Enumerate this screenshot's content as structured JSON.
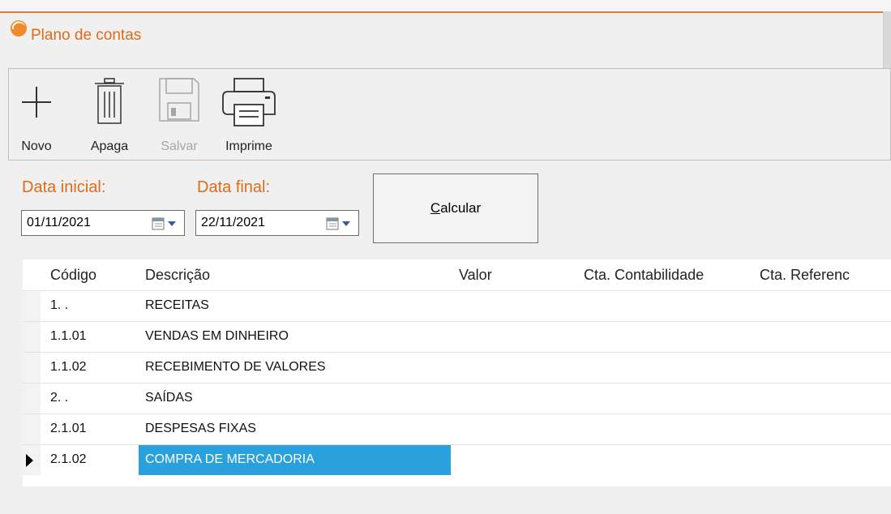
{
  "window": {
    "title": "Plano de contas"
  },
  "toolbar": {
    "novo_label": "Novo",
    "apaga_label": "Apaga",
    "salvar_label": "Salvar",
    "imprime_label": "Imprime"
  },
  "filters": {
    "data_inicial_label": "Data inicial:",
    "data_inicial_value": "01/11/2021",
    "data_final_label": "Data final:",
    "data_final_value": "22/11/2021",
    "calcular_mnemonic": "C",
    "calcular_rest": "alcular"
  },
  "table": {
    "columns": [
      "Código",
      "Descrição",
      "Valor",
      "Cta. Contabilidade",
      "Cta. Referenc"
    ],
    "rows": [
      {
        "codigo": "1. .",
        "descricao": "RECEITAS"
      },
      {
        "codigo": "1.1.01",
        "descricao": "VENDAS EM DINHEIRO"
      },
      {
        "codigo": "1.1.02",
        "descricao": "RECEBIMENTO DE VALORES"
      },
      {
        "codigo": "2. .",
        "descricao": "SAÍDAS"
      },
      {
        "codigo": "2.1.01",
        "descricao": "DESPESAS FIXAS"
      },
      {
        "codigo": "2.1.02",
        "descricao": "COMPRA DE MERCADORIA"
      }
    ]
  },
  "colors": {
    "accent": "#e06a17",
    "selection": "#2aa1dc"
  }
}
